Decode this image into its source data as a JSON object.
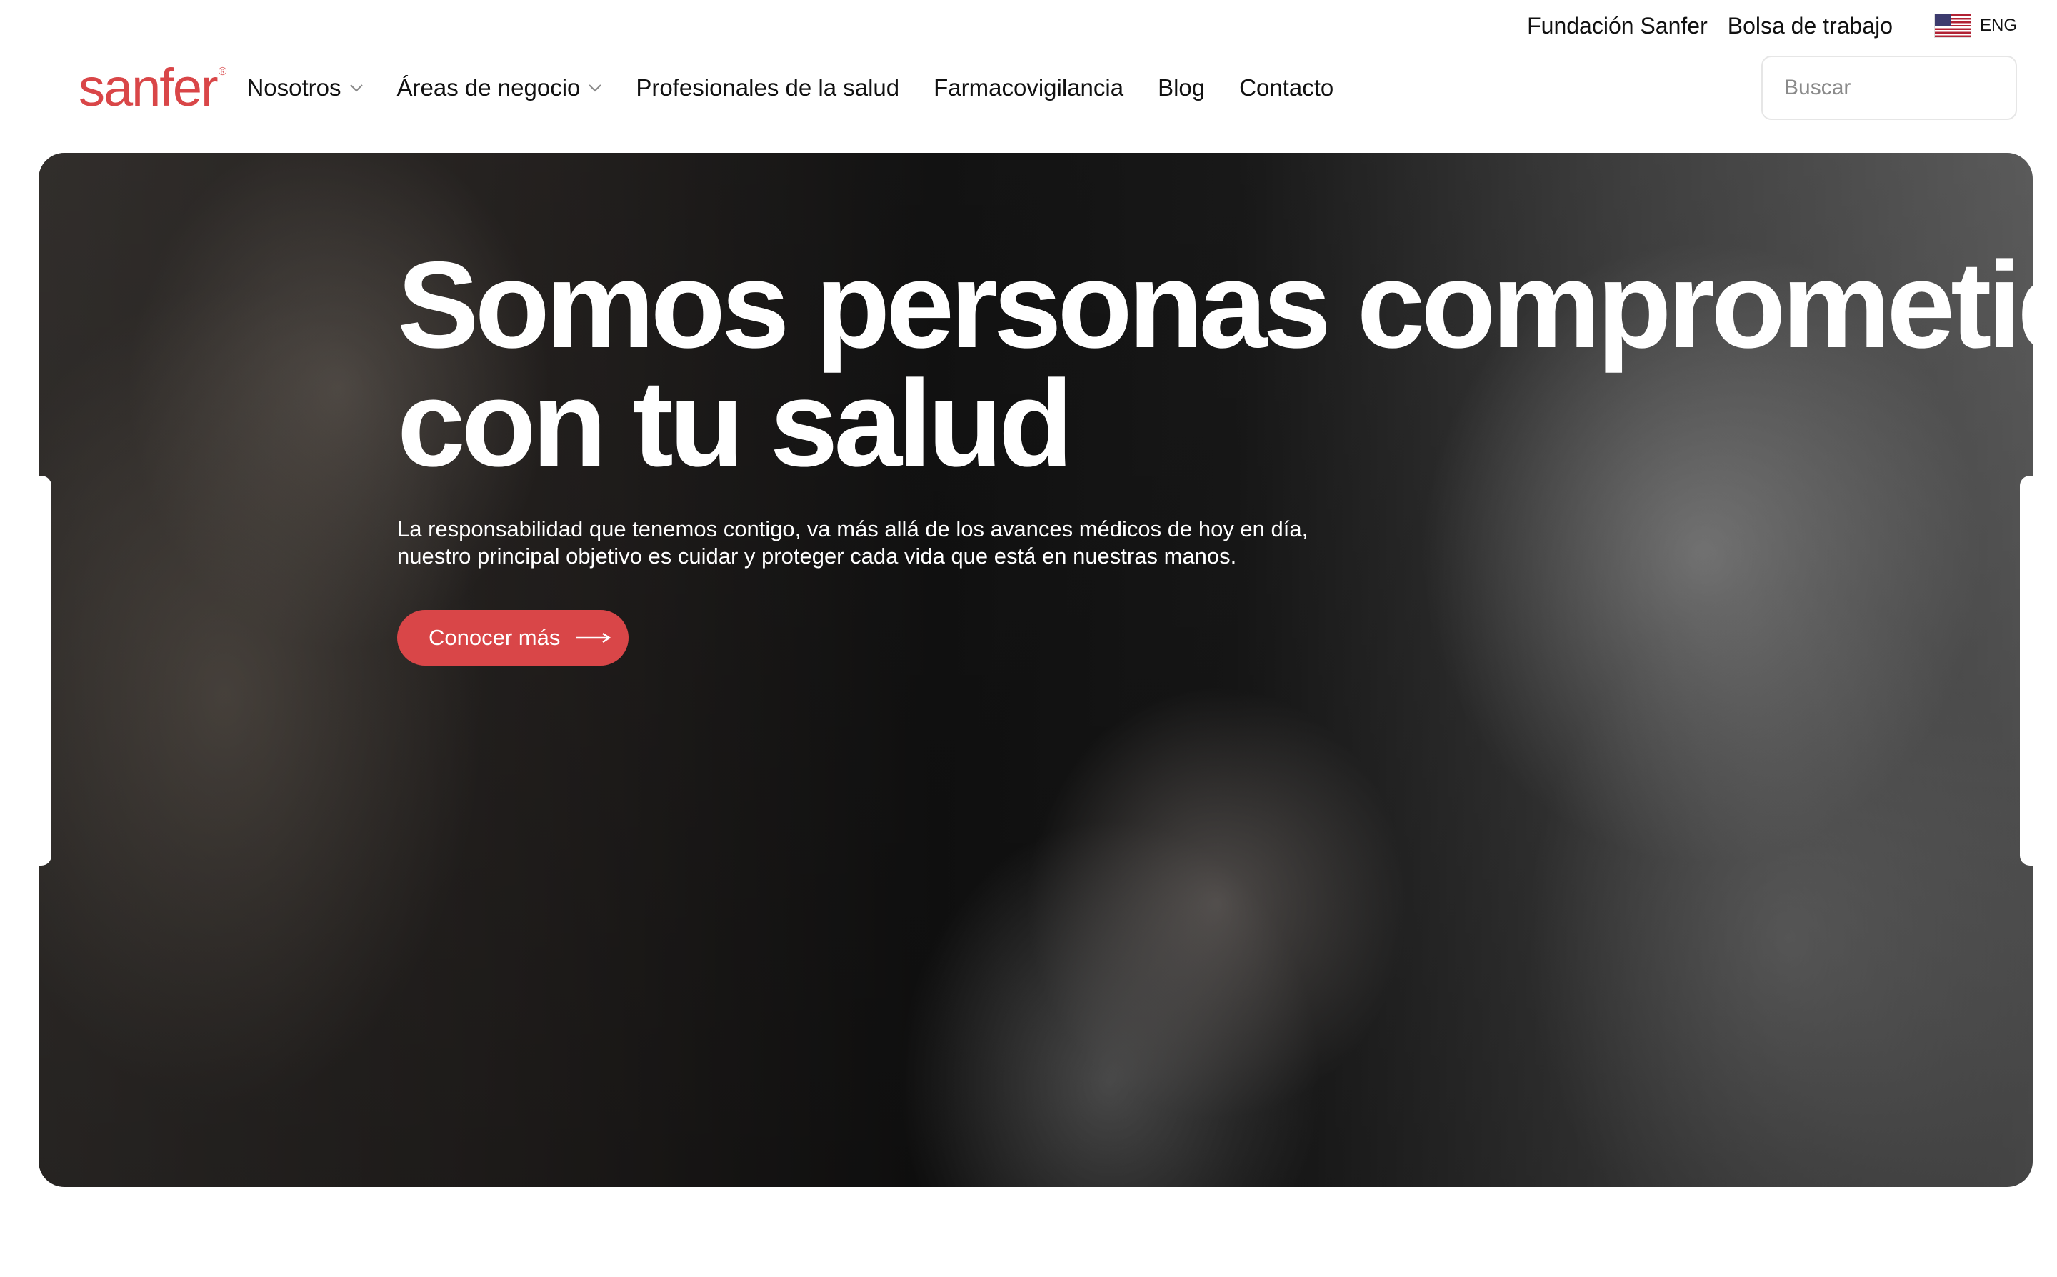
{
  "topbar": {
    "links": [
      "Fundación Sanfer",
      "Bolsa de trabajo"
    ],
    "language": {
      "label": "ENG",
      "flag_icon": "us-flag-icon"
    }
  },
  "header": {
    "logo": {
      "text": "sanfer",
      "reg": "®",
      "color": "#d94648"
    },
    "nav": [
      {
        "label": "Nosotros",
        "has_dropdown": true
      },
      {
        "label": "Áreas de negocio",
        "has_dropdown": true
      },
      {
        "label": "Profesionales de la salud",
        "has_dropdown": false
      },
      {
        "label": "Farmacovigilancia",
        "has_dropdown": false
      },
      {
        "label": "Blog",
        "has_dropdown": false
      },
      {
        "label": "Contacto",
        "has_dropdown": false
      }
    ],
    "search": {
      "placeholder": "Buscar",
      "value": "",
      "icon": "search-icon"
    }
  },
  "hero": {
    "title_line1": "Somos personas comprometidas",
    "title_line2": "con tu salud",
    "subtitle_line1": "La responsabilidad que tenemos contigo, va más allá de los avances médicos de hoy en día,",
    "subtitle_line2": "nuestro principal objetivo es cuidar y proteger cada vida que está en nuestras manos.",
    "cta_label": "Conocer más",
    "accent_color": "#d94648"
  }
}
